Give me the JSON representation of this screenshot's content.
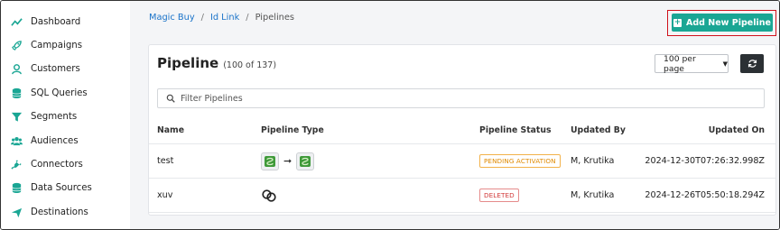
{
  "sidebar": {
    "items": [
      {
        "label": "Dashboard",
        "icon": "trend-line-icon"
      },
      {
        "label": "Campaigns",
        "icon": "rocket-icon"
      },
      {
        "label": "Customers",
        "icon": "user-icon"
      },
      {
        "label": "SQL Queries",
        "icon": "database-icon"
      },
      {
        "label": "Segments",
        "icon": "filter-icon"
      },
      {
        "label": "Audiences",
        "icon": "users-icon"
      },
      {
        "label": "Connectors",
        "icon": "plug-icon"
      },
      {
        "label": "Data Sources",
        "icon": "database-icon"
      },
      {
        "label": "Destinations",
        "icon": "send-icon"
      }
    ]
  },
  "breadcrumb": {
    "items": [
      "Magic Buy",
      "Id Link",
      "Pipelines"
    ],
    "separator": "/"
  },
  "header": {
    "add_label": "Add New Pipeline"
  },
  "card": {
    "title": "Pipeline",
    "count": "(100 of 137)",
    "per_page": "100 per page",
    "search_placeholder": "Filter Pipelines"
  },
  "table": {
    "columns": [
      "Name",
      "Pipeline Type",
      "Pipeline Status",
      "Updated By",
      "Updated On"
    ],
    "rows": [
      {
        "name": "test",
        "type": "source-to-destination",
        "status": "PENDING ACTIVATION",
        "updated_by": "M, Krutika",
        "updated_on": "2024-12-30T07:26:32.998Z"
      },
      {
        "name": "xuv",
        "type": "link",
        "status": "DELETED",
        "updated_by": "M, Krutika",
        "updated_on": "2024-12-26T05:50:18.294Z"
      }
    ]
  },
  "colors": {
    "accent": "#1aa694",
    "highlight_border": "#d0111b",
    "link": "#1a73c9",
    "pending": "#e08a00",
    "deleted": "#d23b3b"
  }
}
